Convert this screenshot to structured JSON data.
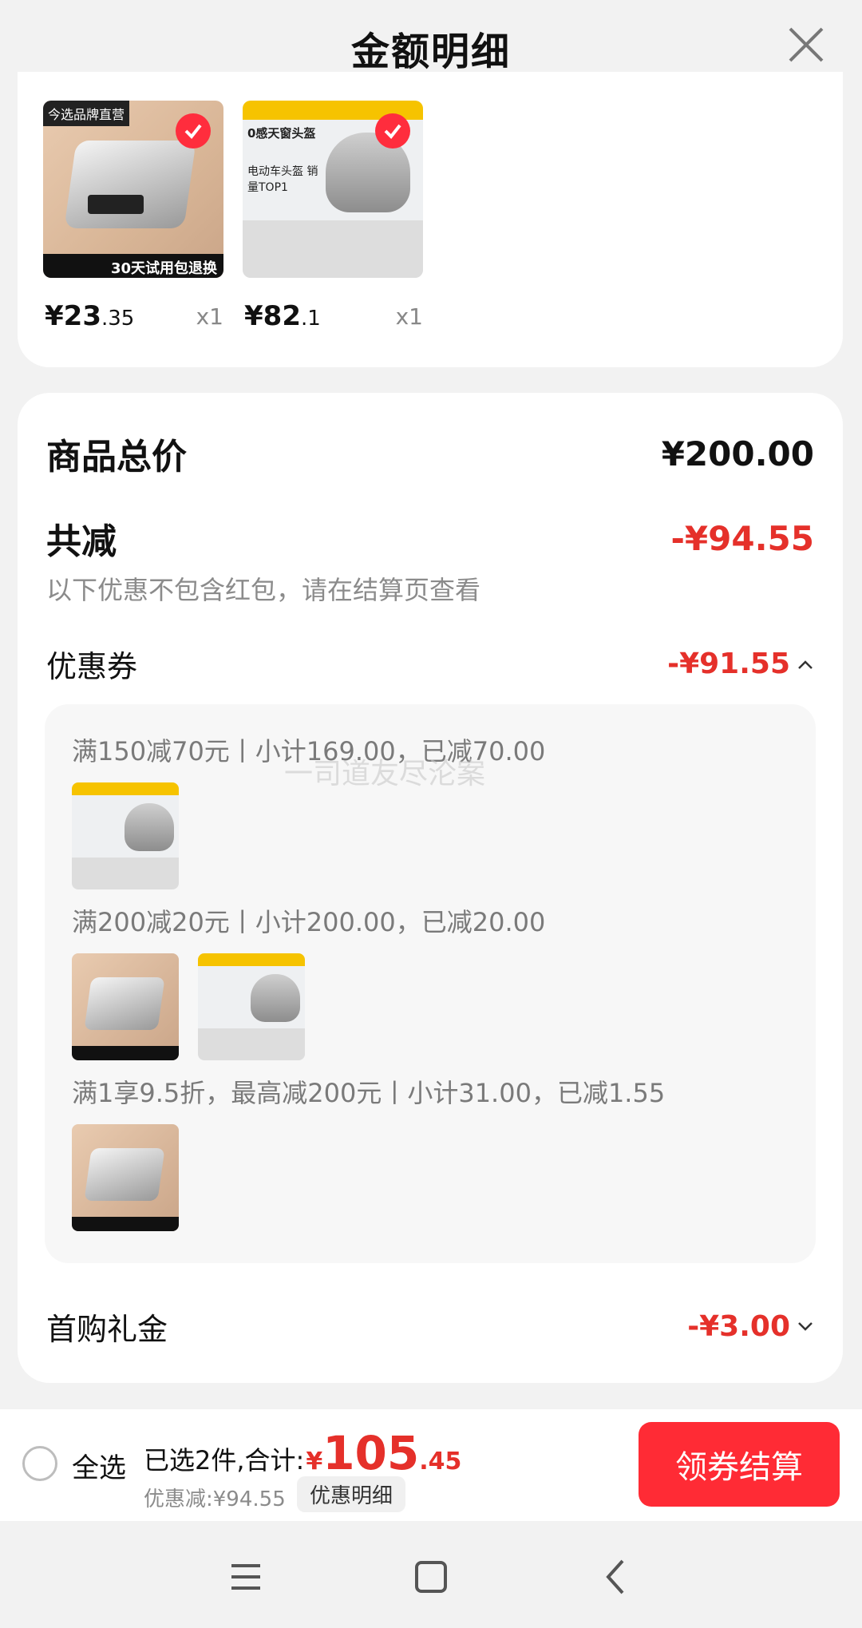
{
  "header": {
    "title": "金额明细"
  },
  "products": [
    {
      "price_int": "¥23",
      "price_dec": ".35",
      "qty": "x1",
      "thumb_text": "30天试用包退换",
      "badge": "今选品牌直营"
    },
    {
      "price_int": "¥82",
      "price_dec": ".1",
      "qty": "x1",
      "thumb_text": "电动车头盔 销量TOP1",
      "badge": "0感天窗头盔"
    }
  ],
  "summary": {
    "total_label": "商品总价",
    "total_value": "¥200.00",
    "reduce_label": "共减",
    "reduce_value": "-¥94.55",
    "note": "以下优惠不包含红包，请在结算页查看"
  },
  "coupons": {
    "label": "优惠券",
    "value": "-¥91.55",
    "items": [
      {
        "text": "满150减70元丨小计169.00，已减70.00"
      },
      {
        "text": "满200减20元丨小计200.00，已减20.00"
      },
      {
        "text": "满1享9.5折，最高减200元丨小计31.00，已减1.55"
      }
    ],
    "watermark": "一司道友尽沦案"
  },
  "first_gift": {
    "label": "首购礼金",
    "value": "-¥3.00"
  },
  "bottom": {
    "select_all": "全选",
    "selected_text": "已选2件,合计:",
    "currency": "¥",
    "total_int": "105",
    "total_dec": ".45",
    "discount_text": "优惠减:¥94.55",
    "detail_button": "优惠明细",
    "checkout_button": "领券结算"
  },
  "colors": {
    "accent": "#ff2b35",
    "price_red": "#e5302a"
  },
  "icons": [
    "close-icon",
    "check-icon",
    "chevron-up-icon",
    "chevron-down-icon",
    "menu-icon",
    "home-icon",
    "back-icon"
  ]
}
